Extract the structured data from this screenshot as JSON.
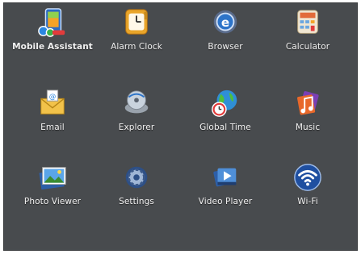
{
  "apps": [
    {
      "label": "Mobile Assistant",
      "icon": "mobile-assistant-icon"
    },
    {
      "label": "Alarm Clock",
      "icon": "alarm-clock-icon"
    },
    {
      "label": "Browser",
      "icon": "browser-icon"
    },
    {
      "label": "Calculator",
      "icon": "calculator-icon"
    },
    {
      "label": "Email",
      "icon": "email-icon"
    },
    {
      "label": "Explorer",
      "icon": "explorer-icon"
    },
    {
      "label": "Global Time",
      "icon": "global-time-icon"
    },
    {
      "label": "Music",
      "icon": "music-icon"
    },
    {
      "label": "Photo Viewer",
      "icon": "photo-viewer-icon"
    },
    {
      "label": "Settings",
      "icon": "settings-icon"
    },
    {
      "label": "Video Player",
      "icon": "video-player-icon"
    },
    {
      "label": "Wi-Fi",
      "icon": "wifi-icon"
    }
  ],
  "theme": {
    "background": "#484b4e",
    "label_color": "#f2f2f2"
  }
}
